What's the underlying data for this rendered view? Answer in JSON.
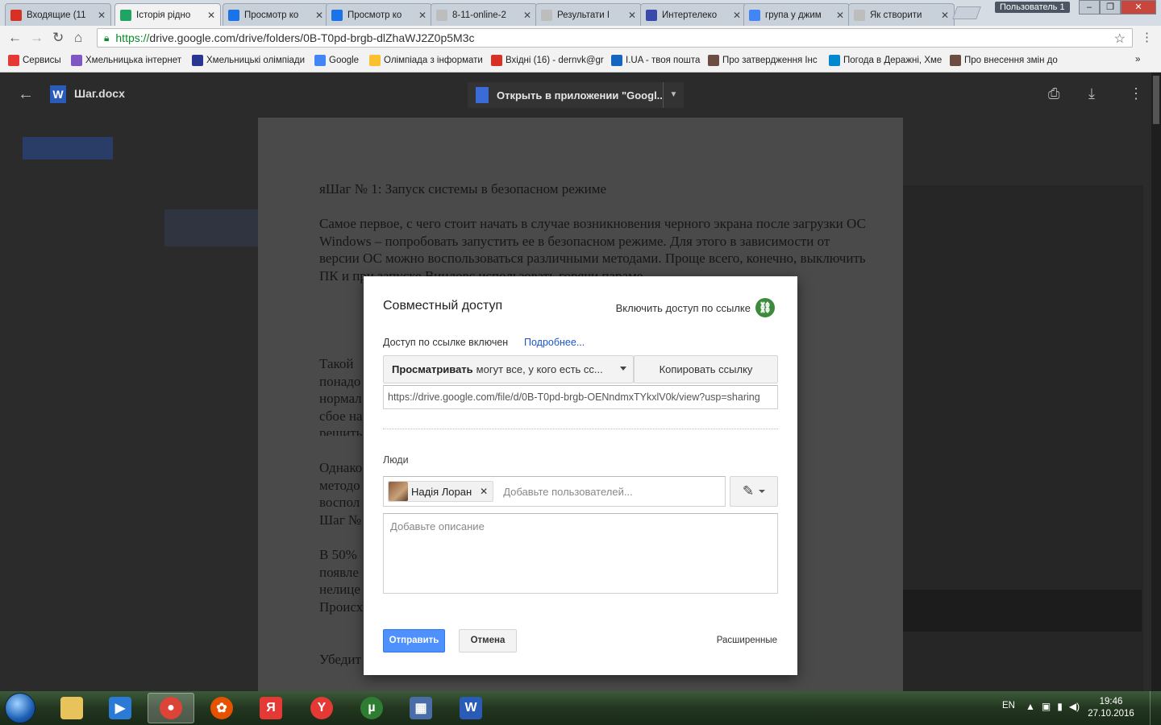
{
  "browser": {
    "tabs": [
      {
        "title": "Входящие (11",
        "color": "#d93025"
      },
      {
        "title": "Історія рідно",
        "color": "#1fa463"
      },
      {
        "title": "Просмотр ко",
        "color": "#1a73e8"
      },
      {
        "title": "Просмотр ко",
        "color": "#1a73e8"
      },
      {
        "title": "8-11-online-2",
        "color": "#9e9e9e"
      },
      {
        "title": "Результати І",
        "color": "#9e9e9e"
      },
      {
        "title": "Интертелеко",
        "color": "#3949ab"
      },
      {
        "title": "група у джим",
        "color": "#4285f4"
      },
      {
        "title": "Як створити",
        "color": "#9e9e9e"
      }
    ],
    "user_badge": "Пользователь 1",
    "url_scheme": "https://",
    "url_rest": "drive.google.com/drive/folders/0B-T0pd-brgb-dlZhaWJ2Z0p5M3c",
    "bookmarks": [
      {
        "label": "Сервисы",
        "color": "#e53935"
      },
      {
        "label": "Хмельницька інтернет",
        "color": "#7e57c2"
      },
      {
        "label": "Хмельницькі олімпіади",
        "color": "#283593"
      },
      {
        "label": "Google",
        "color": "#4285f4"
      },
      {
        "label": "Олімпіада з інформати",
        "color": "#fbc02d"
      },
      {
        "label": "Вхідні (16) - dernvk@gr",
        "color": "#d93025"
      },
      {
        "label": "I.UA - твоя пошта",
        "color": "#1565c0"
      },
      {
        "label": "Про затвердження Інс",
        "color": "#6d4c41"
      },
      {
        "label": "Погода в Деражні, Хме",
        "color": "#0288d1"
      },
      {
        "label": "Про внесення змін до",
        "color": "#6d4c41"
      }
    ]
  },
  "viewer": {
    "file_name": "Шаг.docx",
    "open_with": "Открыть в приложении \"Googl..."
  },
  "document": {
    "paragraphs": [
      "яШаг № 1: Запуск системы в безопасном режиме",
      "Самое первое, с чего стоит начать в случае возникновения черного экрана после загрузки ОС Windows – попробовать запустить ее в безопасном режиме. Для этого в зависимости от версии ОС можно воспользоваться различными методами. Проще всего, конечно, выключить ПК и при запуске Виндовс использовать горячи параме",
      "Такой понадо нормал сбое на решить",
      "Однако методо воспол Шаг №",
      "В 50% появле нелице Происх подлин",
      "Убедит проблема связана с"
    ]
  },
  "dialog": {
    "title": "Совместный доступ",
    "link_toggle": "Включить доступ по ссылке",
    "link_status": "Доступ по ссылке включен",
    "more_link": "Подробнее...",
    "permission_bold": "Просматривать",
    "permission_rest": "могут все, у кого есть сс...",
    "copy_link": "Копировать ссылку",
    "share_url": "https://drive.google.com/file/d/0B-T0pd-brgb-OENndmxTYkxlV0k/view?usp=sharing",
    "people_label": "Люди",
    "person_name": "Надія Лоран",
    "add_users_placeholder": "Добавьте пользователей...",
    "description_placeholder": "Добавьте описание",
    "send": "Отправить",
    "cancel": "Отмена",
    "advanced": "Расширенные"
  },
  "taskbar": {
    "apps": [
      {
        "name": "explorer",
        "color": "#e8c25a"
      },
      {
        "name": "media-player",
        "color": "#2b7bd6"
      },
      {
        "name": "chrome",
        "color": "#db4437"
      },
      {
        "name": "media-center",
        "color": "#e65100"
      },
      {
        "name": "yandex",
        "color": "#e53935"
      },
      {
        "name": "yandex-browser",
        "color": "#e53935"
      },
      {
        "name": "utorrent",
        "color": "#2e7d32"
      },
      {
        "name": "control-panel",
        "color": "#4a6da7"
      },
      {
        "name": "word",
        "color": "#2a5bb8"
      }
    ],
    "language": "EN",
    "time": "19:46",
    "date": "27.10.2016"
  }
}
